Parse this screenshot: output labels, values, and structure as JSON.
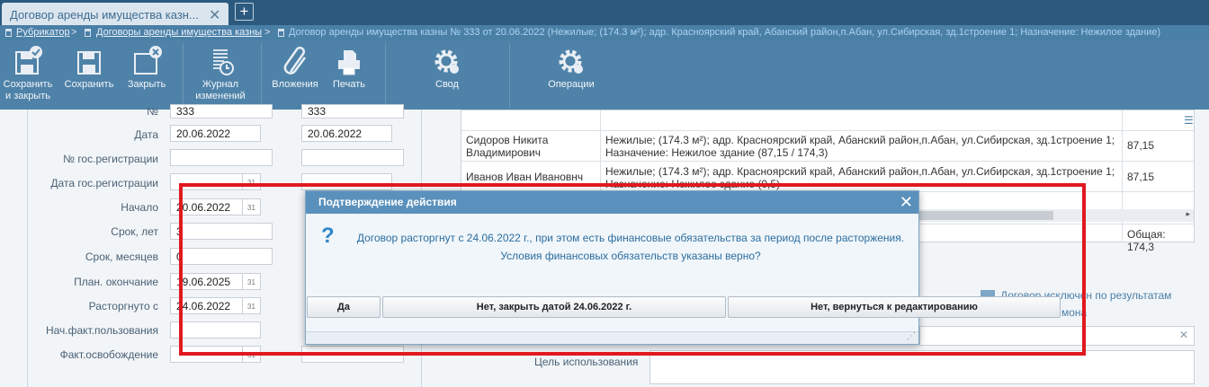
{
  "tab": {
    "title": "Договор аренды имущества казн...",
    "close": "✕",
    "add": "+"
  },
  "breadcrumb": {
    "root": "Рубрикатор",
    "parent": "Договоры аренды имущества казны",
    "current": "Договор аренды имущества казны № 333 от 20.06.2022 (Нежилые; (174.3 м²); адр. Красноярский край, Абанский район,п.Абан, ул.Сибирская, зд.1строение 1; Назначение: Нежилое здание)",
    "sep": ">"
  },
  "toolbar": {
    "save_close": [
      "Сохранить",
      "и закрыть"
    ],
    "save": "Сохранить",
    "close": "Закрыть",
    "log": [
      "Журнал",
      "изменений"
    ],
    "attachments": "Вложения",
    "print": "Печать",
    "summary": "Свод",
    "operations": "Операции"
  },
  "form": {
    "labels": {
      "number": "№",
      "date": "Дата",
      "reg_number": "№ гос.регистрации",
      "reg_date": "Дата гос.регистрации",
      "start": "Начало",
      "term_years": "Срок, лет",
      "term_months": "Срок, месяцев",
      "plan_end": "План. окончание",
      "terminated_from": "Расторгнуто с",
      "actual_use_start": "Нач.факт.пользования",
      "actual_release": "Факт.освобождение",
      "purpose": "Цель использования"
    },
    "values": {
      "number_a": "333",
      "number_b": "333",
      "date_a": "20.06.2022",
      "date_b": "20.06.2022",
      "start": "20.06.2022",
      "term_years": "3",
      "term_months": "0",
      "plan_end": "19.06.2025",
      "terminated_from": "24.06.2022"
    },
    "cal_icon": "31",
    "excluded_label": "Договор исключен по результатам",
    "excluded_label_2": "мона"
  },
  "grid": {
    "rows": [
      {
        "tenant": [
          "Сидоров Никита",
          "Владимирович"
        ],
        "object": [
          "Нежилые; (174.3 м²); адр. Красноярский край, Абанский район,п.Абан, ул.Сибирская, зд.1строение 1;",
          "Назначение: Нежилое здание (87,15 / 174,3)"
        ],
        "share": "87,15"
      },
      {
        "tenant": [
          "Иванов Иван Ивановнч"
        ],
        "object": [
          "Нежилые; (174.3 м²); адр. Красноярский край, Абанский район,п.Абан, ул.Сибирская, зд.1строение 1;",
          "Назначение: Нежилое здание (0,5)"
        ],
        "share": "87,15"
      }
    ],
    "total": "Общая: 174,3"
  },
  "dialog": {
    "title": "Подтверждение действия",
    "icon": "?",
    "message_line1": "Договор расторгнут с 24.06.2022 г., при этом есть финансовые обязательства за период после расторжения.",
    "message_line2": "Условия финансовых обязательств указаны верно?",
    "btn_yes": "Да",
    "btn_close_date": "Нет, закрыть датой 24.06.2022 г.",
    "btn_back": "Нет, вернуться к редактированию"
  }
}
